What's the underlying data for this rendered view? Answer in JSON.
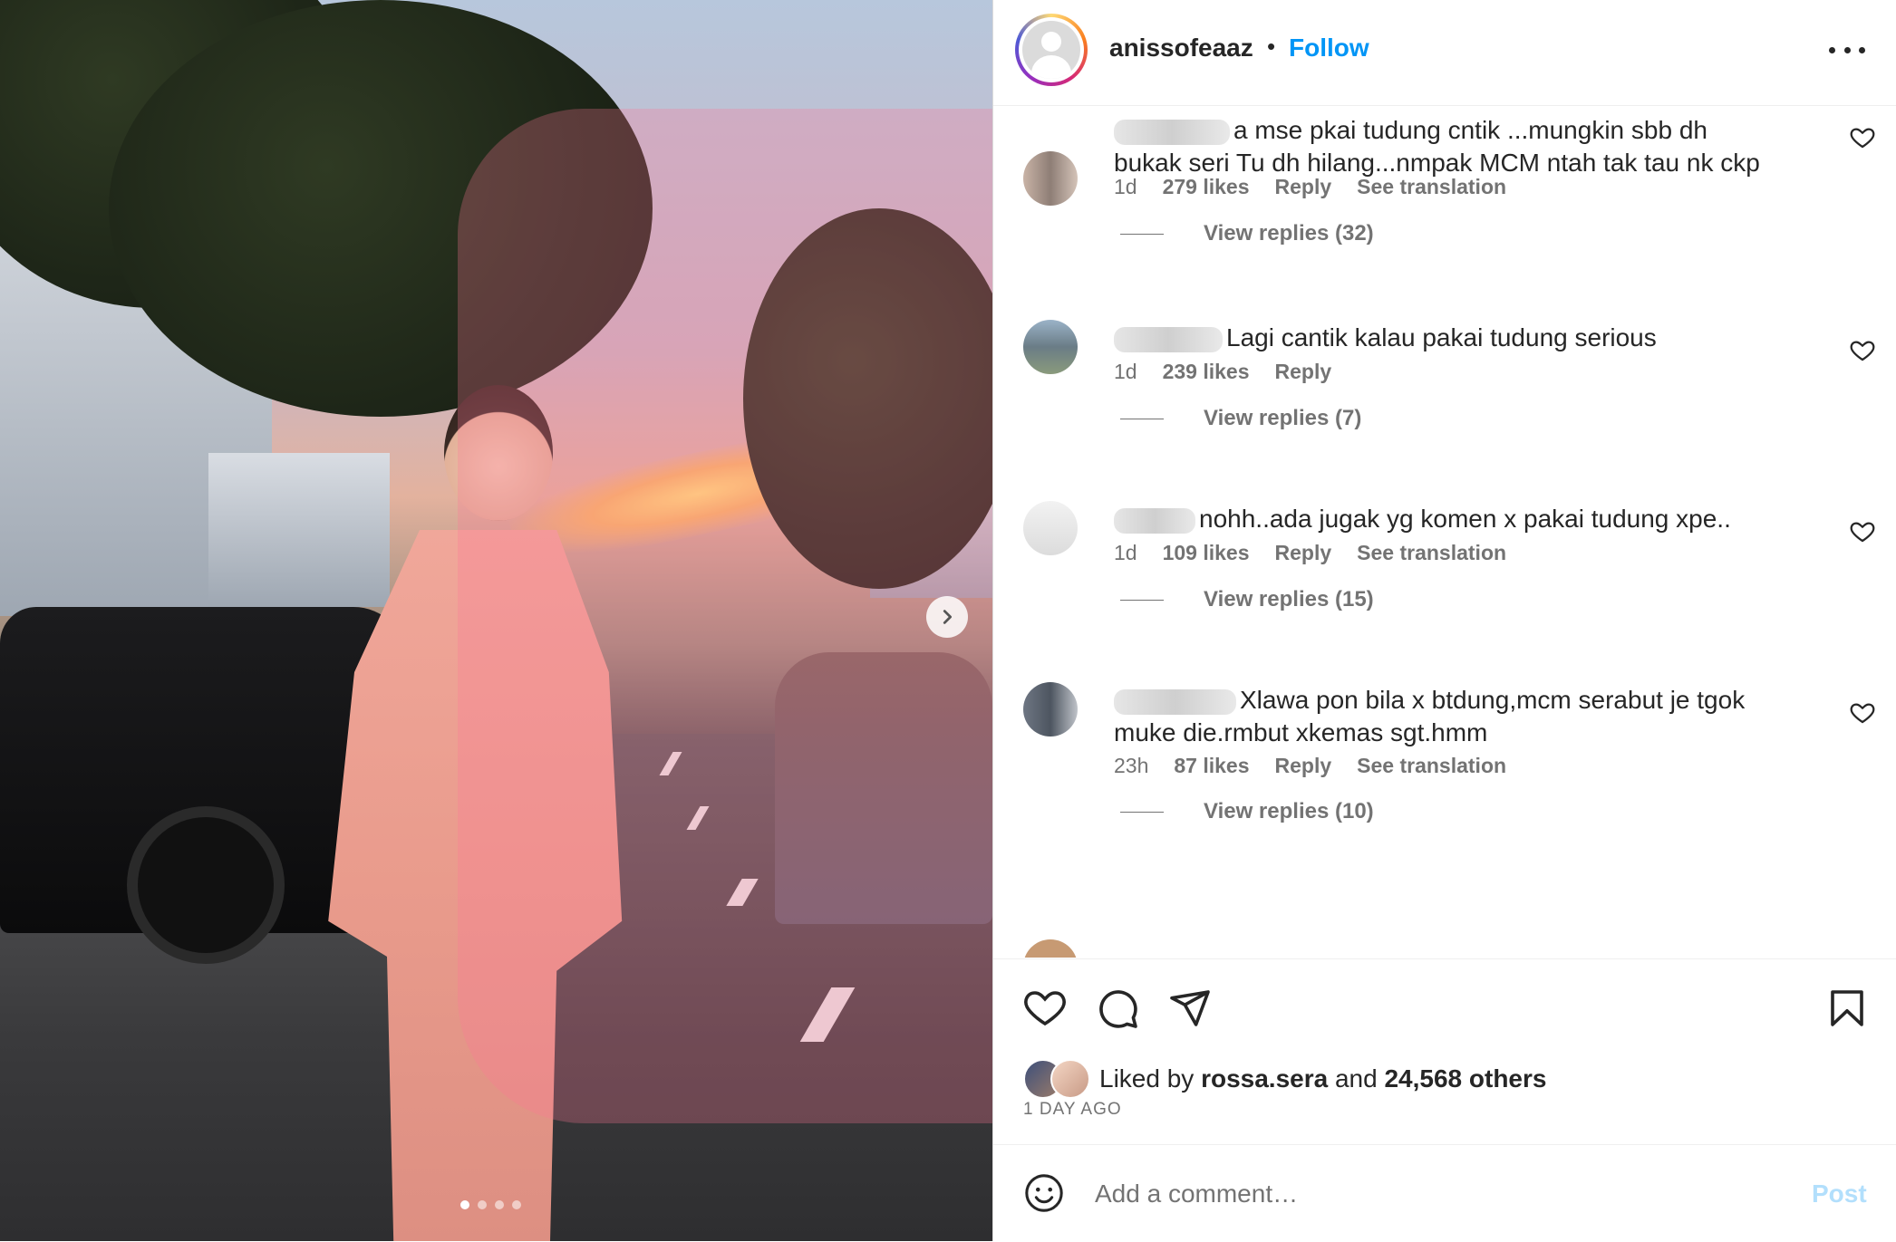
{
  "post": {
    "username": "anissofeaaz",
    "separator": "•",
    "follow_label": "Follow",
    "image_dots": {
      "count": 4,
      "active": 1
    }
  },
  "comments": [
    {
      "text_lines": [
        "a mse pkai tudung cntik ...mungkin sbb dh",
        "bukak seri Tu dh hilang...nmpak MCM ntah tak tau nk ckp"
      ],
      "time": "1d",
      "likes": "279 likes",
      "reply": "Reply",
      "translation": "See translation",
      "view_replies": "View replies (32)"
    },
    {
      "text_lines": [
        "Lagi cantik kalau pakai tudung serious"
      ],
      "time": "1d",
      "likes": "239 likes",
      "reply": "Reply",
      "translation": "",
      "view_replies": "View replies (7)"
    },
    {
      "text_lines": [
        "nohh..ada jugak yg komen x pakai tudung xpe.."
      ],
      "time": "1d",
      "likes": "109 likes",
      "reply": "Reply",
      "translation": "See translation",
      "view_replies": "View replies (15)"
    },
    {
      "text_lines": [
        "Xlawa pon bila x btdung,mcm serabut je tgok",
        "muke die.rmbut xkemas sgt.hmm"
      ],
      "time": "23h",
      "likes": "87 likes",
      "reply": "Reply",
      "translation": "See translation",
      "view_replies": "View replies (10)"
    }
  ],
  "likes": {
    "prefix": "Liked by",
    "user": "rossa.sera",
    "conj": "and",
    "others": "24,568 others"
  },
  "time_ago": "1 DAY AGO",
  "add_comment": {
    "placeholder": "Add a comment…",
    "post_label": "Post"
  },
  "colors": {
    "accent": "#0095f6",
    "text": "#262626",
    "secondary": "#737373",
    "post_disabled": "#b2dffc"
  },
  "icons": [
    "chevron-right-icon",
    "more-icon",
    "heart-icon",
    "comment-icon",
    "share-icon",
    "bookmark-icon",
    "emoji-icon"
  ]
}
